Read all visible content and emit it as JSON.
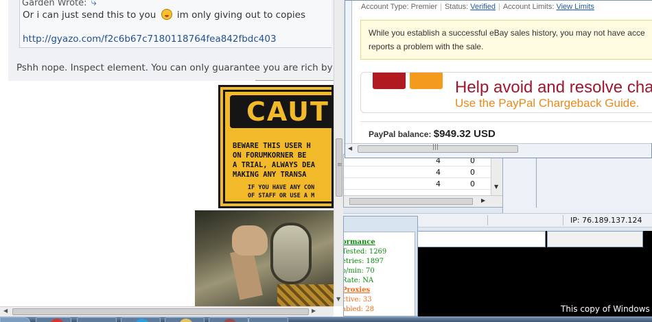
{
  "forum": {
    "quote_header": "Garden Wrote:",
    "quote_text_before": "Or i can just send this to you",
    "quote_text_after": "im only giving out to copies",
    "quote_link": "http://gyazo.com/f2c6b67c7180118764fea842fbdc403",
    "post_text": "Pshh nope. Inspect element. You can only guarantee you are rich by sen",
    "caution_sign": {
      "title": "CAUT",
      "lines": [
        "BEWARE THIS USER H",
        "ON FORUMKORNER BE",
        "A TRIAL, ALWAYS DEA",
        "MAKING ANY TRANSA"
      ],
      "small_lines": [
        "IF YOU HAVE ANY CON",
        "OF STAFF OR USE A M"
      ]
    }
  },
  "paypal": {
    "account_type_label": "Account Type: Premier",
    "status_label": "Status:",
    "status_value": "Verified",
    "account_limits_label": "Account Limits:",
    "account_limits_link": "View Limits",
    "notice_line1": "While you establish a successful eBay sales history, you may not have acce",
    "notice_line2": "reports a problem with the sale.",
    "promo_heading": "Help avoid and resolve charg",
    "promo_subheading": "Use the PayPal Chargeback Guide.",
    "balance_label": "PayPal balance:",
    "balance_value": "$949.32 USD"
  },
  "bg_table": {
    "rows": [
      {
        "a": "4",
        "b": "0"
      },
      {
        "a": "4",
        "b": "0"
      },
      {
        "a": "4",
        "b": "0"
      }
    ]
  },
  "statusbar": {
    "ip": "IP: 76.189.137.124"
  },
  "stats": {
    "performance_header": "ormance",
    "tested": "Tested: 1269",
    "retries": "etries: 1897",
    "per_min": "o/min: 70",
    "rate": "Rate: NA",
    "proxies_header": "Proxies",
    "active": "ctive: 33",
    "disabled": "abled: 28"
  },
  "watermark": "This copy of Windows is"
}
